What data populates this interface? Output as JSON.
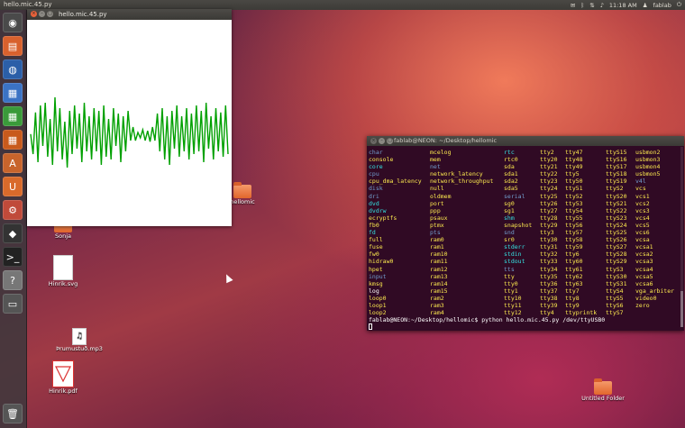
{
  "top_panel": {
    "app_title": "hello.mic.45.py",
    "time": "11:18 AM",
    "user": "fablab"
  },
  "launcher": {
    "items": [
      "dash-icon",
      "files-icon",
      "firefox-icon",
      "writer-icon",
      "calc-icon",
      "impress-icon",
      "software-center-icon",
      "ubuntu-one-icon",
      "settings-icon",
      "inkscape-icon",
      "terminal-icon",
      "help-icon",
      "workspace-icon",
      "trash-icon"
    ]
  },
  "plot_window": {
    "title": "hello.mic.45.py",
    "line_color": "#00a000",
    "signal": [
      0.02,
      -0.35,
      0.42,
      -0.5,
      0.55,
      -0.2,
      0.6,
      -0.4,
      0.3,
      -0.55,
      0.7,
      -0.3,
      0.5,
      -0.45,
      0.25,
      -0.6,
      0.45,
      -0.35,
      0.55,
      -0.25,
      0.4,
      -0.5,
      0.6,
      -0.3,
      0.35,
      -0.45,
      0.5,
      -0.3,
      0.45,
      -0.55,
      0.55,
      -0.4,
      0.3,
      -0.45,
      0.5,
      -0.2,
      0.4,
      -0.5,
      0.35,
      -0.3,
      0.45,
      -0.1,
      0.15,
      -0.1,
      0.05,
      -0.05,
      0.1,
      -0.1,
      0.08,
      -0.12,
      0.15,
      -0.1,
      0.4,
      -0.3,
      0.5,
      -0.45,
      0.35,
      -0.55,
      0.45,
      -0.25,
      0.55,
      -0.4,
      0.35,
      -0.3,
      0.5,
      -0.45,
      0.4,
      -0.35,
      0.55,
      -0.3,
      0.45,
      -0.5,
      0.6,
      -0.25,
      0.35,
      -0.45,
      0.5,
      -0.3,
      0.42,
      -0.4,
      0.55,
      -0.35
    ]
  },
  "terminal": {
    "title": "fablab@NEON: ~/Desktop/hellomic",
    "columns": [
      [
        [
          "char",
          "dir"
        ],
        [
          "console",
          "dev"
        ],
        [
          "core",
          "link"
        ],
        [
          "cpu",
          "dir"
        ],
        [
          "cpu_dma_latency",
          "dev"
        ],
        [
          "disk",
          "dir"
        ],
        [
          "dri",
          "dir"
        ],
        [
          "dvd",
          "link"
        ],
        [
          "dvdrw",
          "link"
        ],
        [
          "ecryptfs",
          "dev"
        ],
        [
          "fb0",
          "dev"
        ],
        [
          "fd",
          "link"
        ],
        [
          "full",
          "dev"
        ],
        [
          "fuse",
          "dev"
        ],
        [
          "fw0",
          "dev"
        ],
        [
          "hidraw0",
          "dev"
        ],
        [
          "hpet",
          "dev"
        ],
        [
          "input",
          "dir"
        ],
        [
          "kmsg",
          "dev"
        ],
        [
          "log",
          "file"
        ],
        [
          "loop0",
          "dev"
        ],
        [
          "loop1",
          "dev"
        ],
        [
          "loop2",
          "dev"
        ]
      ],
      [
        [
          "mcelog",
          "dev"
        ],
        [
          "mem",
          "dev"
        ],
        [
          "net",
          "dir"
        ],
        [
          "network_latency",
          "dev"
        ],
        [
          "network_throughput",
          "dev"
        ],
        [
          "null",
          "dev"
        ],
        [
          "oldmem",
          "dev"
        ],
        [
          "port",
          "dev"
        ],
        [
          "ppp",
          "dev"
        ],
        [
          "psaux",
          "dev"
        ],
        [
          "ptmx",
          "dev"
        ],
        [
          "pts",
          "dir"
        ],
        [
          "ram0",
          "dev"
        ],
        [
          "ram1",
          "dev"
        ],
        [
          "ram10",
          "dev"
        ],
        [
          "ram11",
          "dev"
        ],
        [
          "ram12",
          "dev"
        ],
        [
          "ram13",
          "dev"
        ],
        [
          "ram14",
          "dev"
        ],
        [
          "ram15",
          "dev"
        ],
        [
          "ram2",
          "dev"
        ],
        [
          "ram3",
          "dev"
        ],
        [
          "ram4",
          "dev"
        ]
      ],
      [
        [
          "rtc",
          "link"
        ],
        [
          "rtc0",
          "dev"
        ],
        [
          "sda",
          "dev"
        ],
        [
          "sda1",
          "dev"
        ],
        [
          "sda2",
          "dev"
        ],
        [
          "sda5",
          "dev"
        ],
        [
          "serial",
          "dir"
        ],
        [
          "sg0",
          "dev"
        ],
        [
          "sg1",
          "dev"
        ],
        [
          "shm",
          "link"
        ],
        [
          "snapshot",
          "dev"
        ],
        [
          "snd",
          "dir"
        ],
        [
          "sr0",
          "dev"
        ],
        [
          "stderr",
          "link"
        ],
        [
          "stdin",
          "link"
        ],
        [
          "stdout",
          "link"
        ],
        [
          "tts",
          "dir"
        ],
        [
          "tty",
          "dev"
        ],
        [
          "tty0",
          "dev"
        ],
        [
          "tty1",
          "dev"
        ],
        [
          "tty10",
          "dev"
        ],
        [
          "tty11",
          "dev"
        ],
        [
          "tty12",
          "dev"
        ]
      ],
      [
        [
          "tty2",
          "dev"
        ],
        [
          "tty20",
          "dev"
        ],
        [
          "tty21",
          "dev"
        ],
        [
          "tty22",
          "dev"
        ],
        [
          "tty23",
          "dev"
        ],
        [
          "tty24",
          "dev"
        ],
        [
          "tty25",
          "dev"
        ],
        [
          "tty26",
          "dev"
        ],
        [
          "tty27",
          "dev"
        ],
        [
          "tty28",
          "dev"
        ],
        [
          "tty29",
          "dev"
        ],
        [
          "tty3",
          "dev"
        ],
        [
          "tty30",
          "dev"
        ],
        [
          "tty31",
          "dev"
        ],
        [
          "tty32",
          "dev"
        ],
        [
          "tty33",
          "dev"
        ],
        [
          "tty34",
          "dev"
        ],
        [
          "tty35",
          "dev"
        ],
        [
          "tty36",
          "dev"
        ],
        [
          "tty37",
          "dev"
        ],
        [
          "tty38",
          "dev"
        ],
        [
          "tty39",
          "dev"
        ],
        [
          "tty4",
          "dev"
        ]
      ],
      [
        [
          "tty47",
          "dev"
        ],
        [
          "tty48",
          "dev"
        ],
        [
          "tty49",
          "dev"
        ],
        [
          "tty5",
          "dev"
        ],
        [
          "tty50",
          "dev"
        ],
        [
          "tty51",
          "dev"
        ],
        [
          "tty52",
          "dev"
        ],
        [
          "tty53",
          "dev"
        ],
        [
          "tty54",
          "dev"
        ],
        [
          "tty55",
          "dev"
        ],
        [
          "tty56",
          "dev"
        ],
        [
          "tty57",
          "dev"
        ],
        [
          "tty58",
          "dev"
        ],
        [
          "tty59",
          "dev"
        ],
        [
          "tty6",
          "dev"
        ],
        [
          "tty60",
          "dev"
        ],
        [
          "tty61",
          "dev"
        ],
        [
          "tty62",
          "dev"
        ],
        [
          "tty63",
          "dev"
        ],
        [
          "tty7",
          "dev"
        ],
        [
          "tty8",
          "dev"
        ],
        [
          "tty9",
          "dev"
        ],
        [
          "ttyprintk",
          "dev"
        ]
      ],
      [
        [
          "ttyS15",
          "dev"
        ],
        [
          "ttyS16",
          "dev"
        ],
        [
          "ttyS17",
          "dev"
        ],
        [
          "ttyS18",
          "dev"
        ],
        [
          "ttyS19",
          "dev"
        ],
        [
          "ttyS2",
          "dev"
        ],
        [
          "ttyS20",
          "dev"
        ],
        [
          "ttyS21",
          "dev"
        ],
        [
          "ttyS22",
          "dev"
        ],
        [
          "ttyS23",
          "dev"
        ],
        [
          "ttyS24",
          "dev"
        ],
        [
          "ttyS25",
          "dev"
        ],
        [
          "ttyS26",
          "dev"
        ],
        [
          "ttyS27",
          "dev"
        ],
        [
          "ttyS28",
          "dev"
        ],
        [
          "ttyS29",
          "dev"
        ],
        [
          "ttyS3",
          "dev"
        ],
        [
          "ttyS30",
          "dev"
        ],
        [
          "ttyS31",
          "dev"
        ],
        [
          "ttyS4",
          "dev"
        ],
        [
          "ttyS5",
          "dev"
        ],
        [
          "ttyS6",
          "dev"
        ],
        [
          "ttyS7",
          "dev"
        ]
      ],
      [
        [
          "usbmon2",
          "dev"
        ],
        [
          "usbmon3",
          "dev"
        ],
        [
          "usbmon4",
          "dev"
        ],
        [
          "usbmon5",
          "dev"
        ],
        [
          "v4l",
          "dir"
        ],
        [
          "vcs",
          "dev"
        ],
        [
          "vcs1",
          "dev"
        ],
        [
          "vcs2",
          "dev"
        ],
        [
          "vcs3",
          "dev"
        ],
        [
          "vcs4",
          "dev"
        ],
        [
          "vcs5",
          "dev"
        ],
        [
          "vcs6",
          "dev"
        ],
        [
          "vcsa",
          "dev"
        ],
        [
          "vcsa1",
          "dev"
        ],
        [
          "vcsa2",
          "dev"
        ],
        [
          "vcsa3",
          "dev"
        ],
        [
          "vcsa4",
          "dev"
        ],
        [
          "vcsa5",
          "dev"
        ],
        [
          "vcsa6",
          "dev"
        ],
        [
          "vga_arbiter",
          "dev"
        ],
        [
          "video0",
          "dev"
        ],
        [
          "zero",
          "dev"
        ]
      ]
    ],
    "prompt": "fablab@NEON:~/Desktop/hellomic$ python hello.mic.45.py /dev/ttyUSB0"
  },
  "desktop_icons": {
    "hellomic": "hellomic",
    "sonja": "Sonja",
    "hinrik_svg": "Hinrik.svg",
    "mp3": "Þrumustuð.mp3",
    "hinrik_pdf": "Hinrik.pdf",
    "untitled": "Untitled Folder"
  }
}
